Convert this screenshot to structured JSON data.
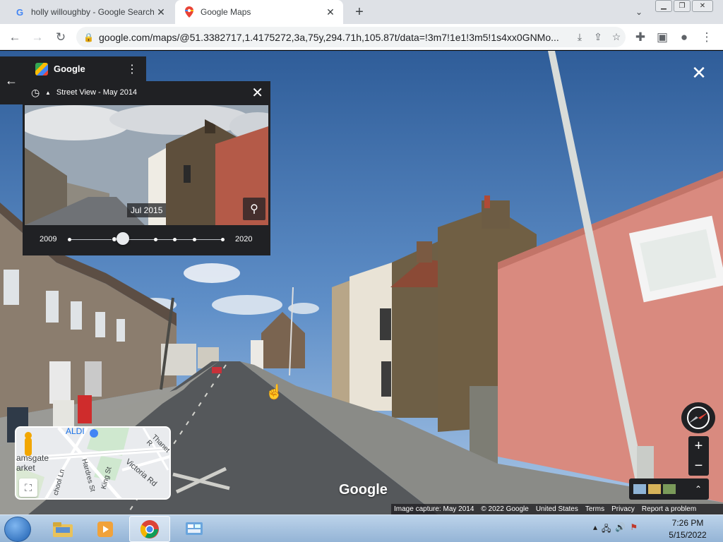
{
  "browser": {
    "tabs": [
      {
        "title": "holly willoughby - Google Search",
        "favicon": "google-g-icon",
        "active": false
      },
      {
        "title": "Google Maps",
        "favicon": "google-maps-pin-icon",
        "active": true
      }
    ],
    "url": "google.com/maps/@51.3382717,1.4175272,3a,75y,294.71h,105.87t/data=!3m7!1e1!3m5!1s4xx0GNMo..."
  },
  "maps_card": {
    "title": "Google"
  },
  "time_machine": {
    "header": "Street View - May 2014",
    "thumb_date": "Jul 2015",
    "slider_start": "2009",
    "slider_end": "2020",
    "slider_position": 0.35
  },
  "minimap": {
    "labels": {
      "aldi": "ALDI",
      "market": "amsgate",
      "market2": "arket",
      "victoria": "Victoria Rd",
      "thanet": "Thanet R",
      "hardres": "Hardres St",
      "king": "King St",
      "school": "chool Ln"
    }
  },
  "watermark": "Google",
  "footer": {
    "capture": "Image capture: May 2014",
    "copyright": "© 2022 Google",
    "country": "United States",
    "terms": "Terms",
    "privacy": "Privacy",
    "report": "Report a problem"
  },
  "taskbar": {
    "time": "7:26 PM",
    "date": "5/15/2022"
  },
  "colors": {
    "panel": "#202124",
    "chrome_tabstrip": "#dee1e6",
    "taskbar": "#a9c4e0"
  }
}
